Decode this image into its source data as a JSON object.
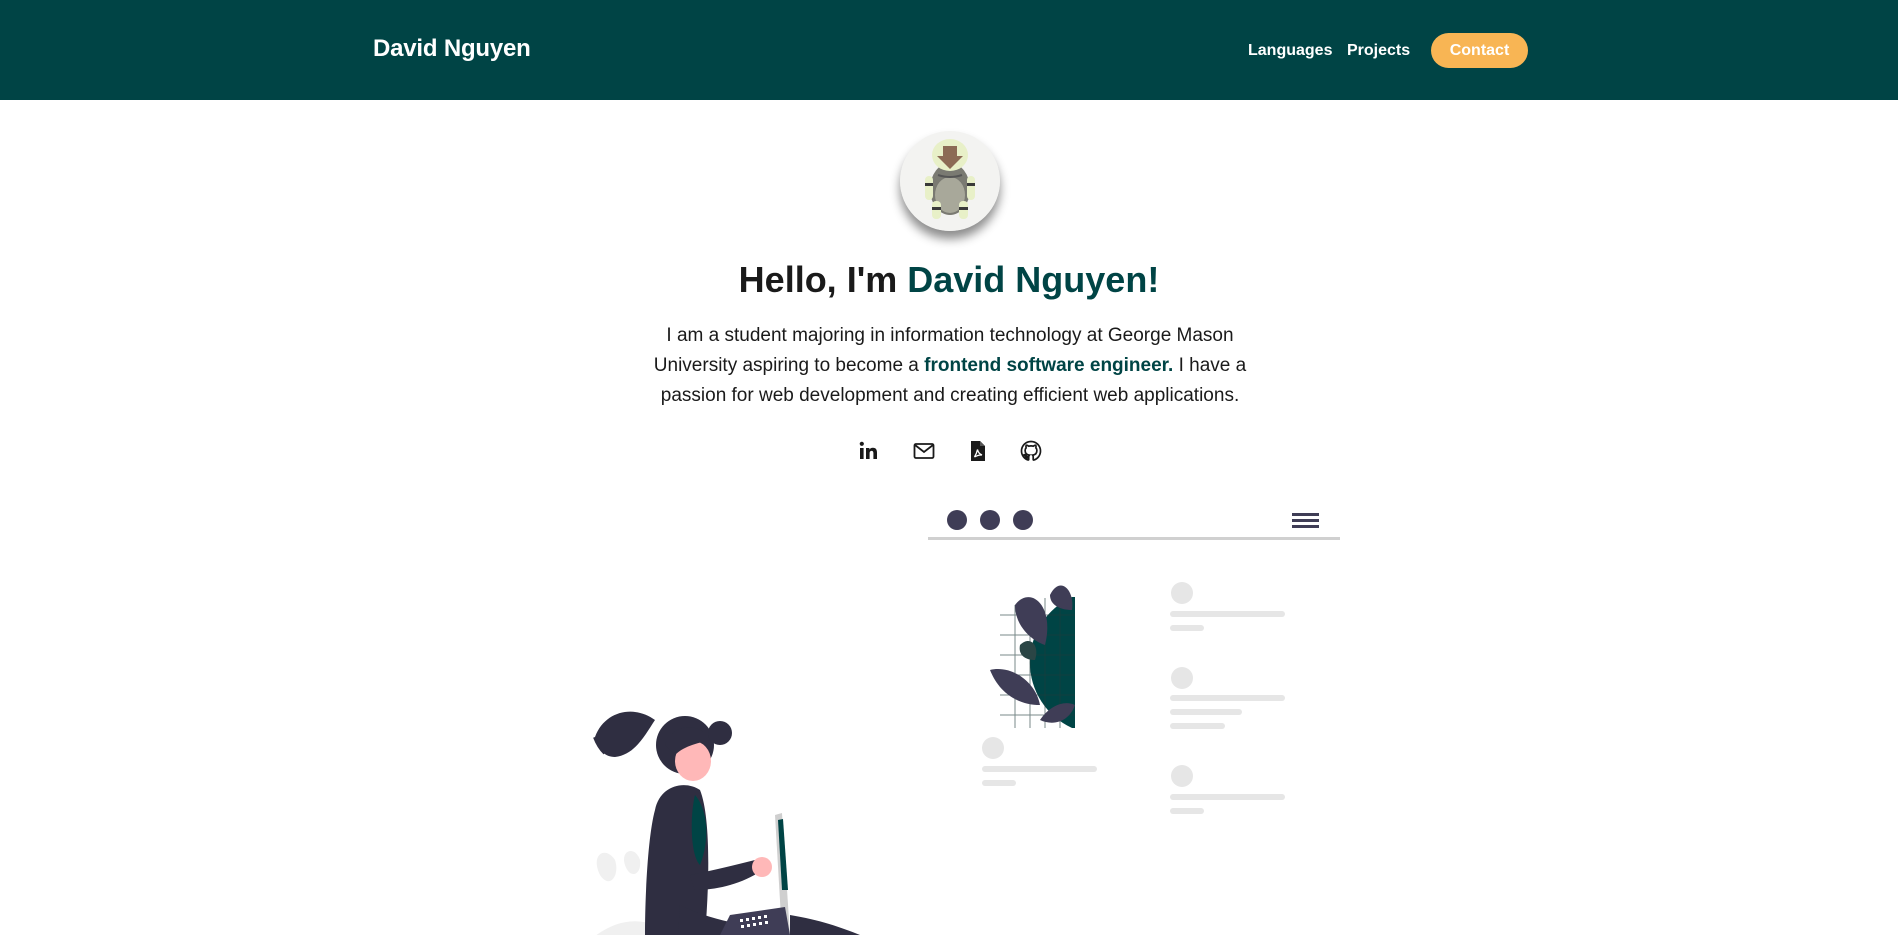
{
  "navbar": {
    "brand": "David Nguyen",
    "links": [
      "Languages",
      "Projects"
    ],
    "contact_label": "Contact"
  },
  "hero": {
    "greeting": "Hello, I'm ",
    "name": "David Nguyen!",
    "bio_before": "I am a student majoring in information technology at George Mason University aspiring to become a ",
    "bio_highlight": "frontend software engineer.",
    "bio_after": " I have a passion for web development and creating efficient web applications."
  },
  "social_icons": [
    "linkedin-icon",
    "mail-icon",
    "pdf-file-icon",
    "github-icon"
  ],
  "colors": {
    "primary": "#004445",
    "accent": "#f8b554",
    "text": "#1a1a1a",
    "illustration_dark": "#3f3d56"
  }
}
